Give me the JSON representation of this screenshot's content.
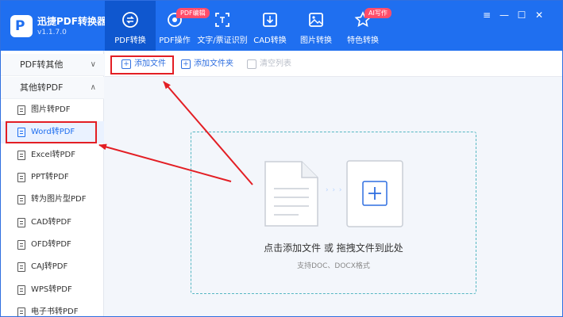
{
  "app": {
    "name": "迅捷PDF转换器",
    "version": "v1.1.7.0",
    "logo_glyph": "P"
  },
  "nav": {
    "tabs": [
      {
        "label": "PDF转换",
        "icon": "convert-icon",
        "active": true
      },
      {
        "label": "PDF操作",
        "icon": "pdf-ops-icon",
        "badge": "PDF编辑"
      },
      {
        "label": "文字/票证识别",
        "icon": "ocr-icon"
      },
      {
        "label": "CAD转换",
        "icon": "cad-icon"
      },
      {
        "label": "图片转换",
        "icon": "image-icon"
      },
      {
        "label": "特色转换",
        "icon": "special-icon",
        "badge": "AI写作"
      }
    ]
  },
  "window_controls": {
    "menu": "≡",
    "minimize": "—",
    "maximize": "☐",
    "close": "✕"
  },
  "sidebar": {
    "groups": [
      {
        "label": "PDF转其他",
        "chevron": "∨",
        "expanded": false
      },
      {
        "label": "其他转PDF",
        "chevron": "∧",
        "expanded": true
      }
    ],
    "items": [
      {
        "label": "图片转PDF"
      },
      {
        "label": "Word转PDF",
        "active": true
      },
      {
        "label": "Excel转PDF"
      },
      {
        "label": "PPT转PDF"
      },
      {
        "label": "转为图片型PDF"
      },
      {
        "label": "CAD转PDF"
      },
      {
        "label": "OFD转PDF"
      },
      {
        "label": "CAJ转PDF"
      },
      {
        "label": "WPS转PDF"
      },
      {
        "label": "电子书转PDF"
      }
    ]
  },
  "toolbar": {
    "add_file": "添加文件",
    "add_folder": "添加文件夹",
    "clear_list": "清空列表"
  },
  "drop_zone": {
    "main_text": "点击添加文件 或 拖拽文件到此处",
    "sub_text": "支持DOC、DOCX格式",
    "chevrons": "› › ›",
    "plus": "+"
  },
  "colors": {
    "brand_blue": "#1f6ff0",
    "active_tab": "#0f57cf",
    "annotation_red": "#e31e24",
    "badge_pink": "#ff4d6a",
    "dashed_border": "#55b7c2"
  }
}
